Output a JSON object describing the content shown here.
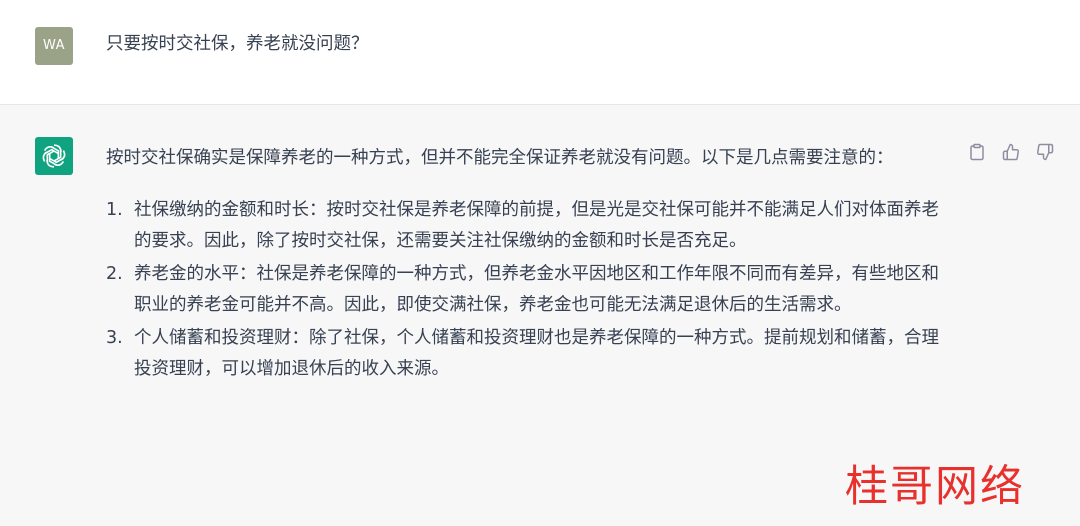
{
  "user_message": {
    "avatar_initials": "WA",
    "text": "只要按时交社保，养老就没问题？"
  },
  "assistant_message": {
    "avatar_icon": "openai-logo-icon",
    "intro": "按时交社保确实是保障养老的一种方式，但并不能完全保证养老就没有问题。以下是几点需要注意的：",
    "items": [
      {
        "number": "1.",
        "text": "社保缴纳的金额和时长：按时交社保是养老保障的前提，但是光是交社保可能并不能满足人们对体面养老的要求。因此，除了按时交社保，还需要关注社保缴纳的金额和时长是否充足。"
      },
      {
        "number": "2.",
        "text": "养老金的水平：社保是养老保障的一种方式，但养老金水平因地区和工作年限不同而有差异，有些地区和职业的养老金可能并不高。因此，即使交满社保，养老金也可能无法满足退休后的生活需求。"
      },
      {
        "number": "3.",
        "text": "个人储蓄和投资理财：除了社保，个人储蓄和投资理财也是养老保障的一种方式。提前规划和储蓄，合理投资理财，可以增加退休后的收入来源。"
      }
    ],
    "actions": [
      "copy-icon",
      "thumbs-up-icon",
      "thumbs-down-icon"
    ]
  },
  "watermark": "桂哥网络",
  "colors": {
    "user_avatar_bg": "#9aa288",
    "gpt_avatar_bg": "#10a37f",
    "assistant_bg": "#f7f7f8",
    "watermark": "#e8302d"
  }
}
